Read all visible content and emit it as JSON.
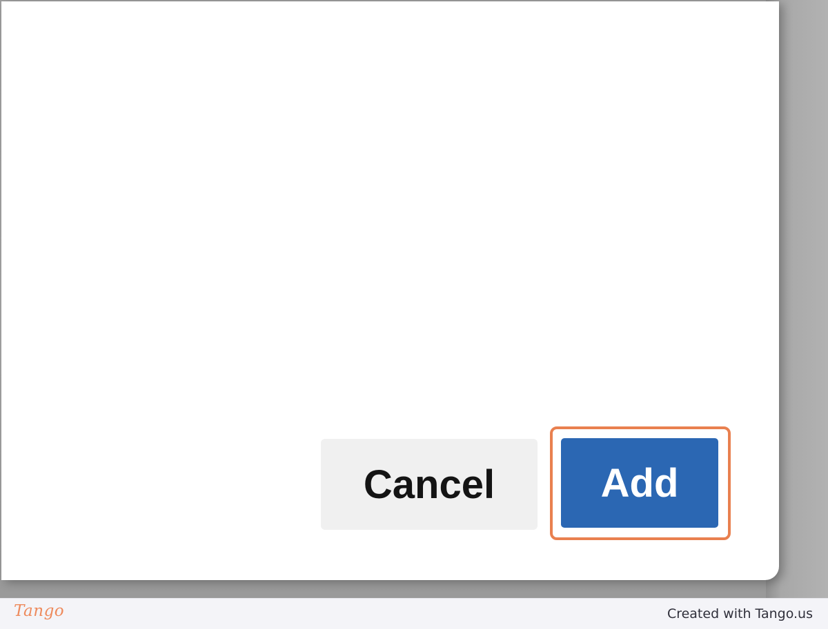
{
  "dialog": {
    "cancel_label": "Cancel",
    "add_label": "Add"
  },
  "footer": {
    "logo_text": "Tango",
    "credit_text": "Created with Tango.us"
  },
  "colors": {
    "add_button": "#2b67b3",
    "cancel_button": "#f0f0f0",
    "highlight": "#e9804f",
    "logo": "#ee8a5c"
  }
}
